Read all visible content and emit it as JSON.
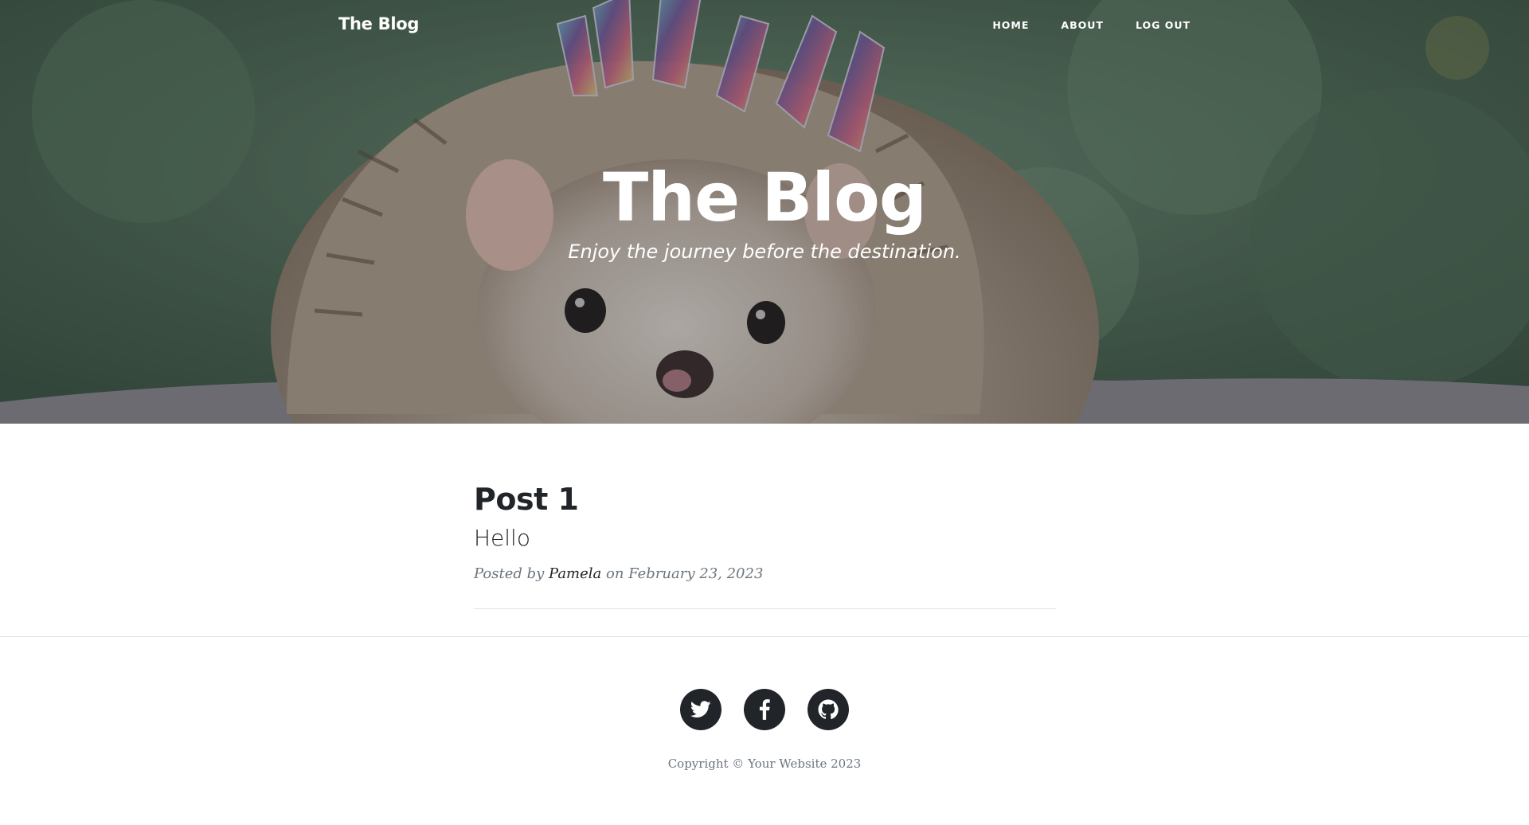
{
  "navbar": {
    "brand": "The Blog",
    "links": [
      "Home",
      "About",
      "Log Out"
    ]
  },
  "hero": {
    "title": "The Blog",
    "subtitle": "Enjoy the journey before the destination."
  },
  "posts": [
    {
      "title": "Post 1",
      "subtitle": "Hello",
      "meta_prefix": "Posted by",
      "author": "Pamela",
      "meta_date": "on February 23, 2023"
    }
  ],
  "footer": {
    "social_icons": [
      "twitter-icon",
      "facebook-icon",
      "github-icon"
    ],
    "copyright": "Copyright © Your Website 2023"
  },
  "colors": {
    "text_dark": "#212529",
    "text_muted": "#6c757d",
    "divider": "#dee2e6",
    "hero_green": "#4f6b57"
  }
}
